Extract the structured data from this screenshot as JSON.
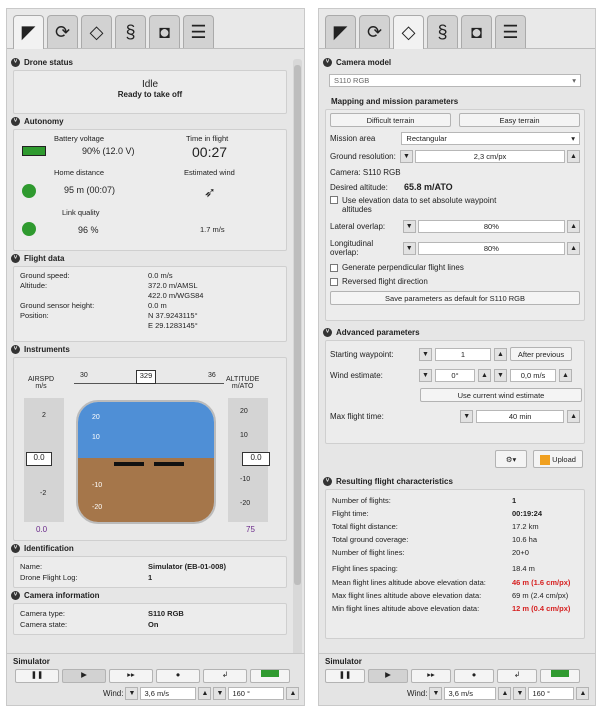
{
  "tabs": [
    "plane-icon",
    "refresh-icon",
    "diamond-icon",
    "spiral-icon",
    "camera-icon",
    "sliders-icon"
  ],
  "left": {
    "drone_status": {
      "title": "Drone status",
      "state": "Idle",
      "sub": "Ready to take off"
    },
    "autonomy": {
      "title": "Autonomy",
      "battery_label": "Battery voltage",
      "battery_value": "90% (12.0 V)",
      "time_label": "Time in flight",
      "time_value": "00:27",
      "home_label": "Home distance",
      "home_value": "95 m (00:07)",
      "wind_label": "Estimated wind",
      "wind_value": "1.7 m/s",
      "link_label": "Link quality",
      "link_value": "96 %"
    },
    "flight_data": {
      "title": "Flight data",
      "rows": [
        {
          "k": "Ground speed:",
          "v": "0.0 m/s"
        },
        {
          "k": "Altitude:",
          "v": "372.0 m/AMSL",
          "v2": "422.0 m/WGS84"
        },
        {
          "k": "Ground sensor height:",
          "v": "0.0 m"
        },
        {
          "k": "Position:",
          "v": "N 37.9243115°",
          "v2": "E 29.1283145°"
        }
      ]
    },
    "instruments": {
      "title": "Instruments",
      "heading": "329",
      "hdg_left": "30",
      "hdg_right": "36",
      "airspd_label": "AIRSPD",
      "airspd_unit": "m/s",
      "alt_label": "ALTITUDE",
      "alt_unit": "m/ATO",
      "speed_box": "0.0",
      "alt_box": "0.0",
      "speed_bottom": "0.0",
      "alt_bottom": "75",
      "spd_ticks": [
        "2",
        "-2"
      ],
      "alt_ticks": [
        "20",
        "10",
        "-10",
        "-20"
      ],
      "pitch_up": [
        "20",
        "10"
      ],
      "pitch_down": [
        "-10",
        "-20"
      ]
    },
    "identification": {
      "title": "Identification",
      "name_k": "Name:",
      "name_v": "Simulator (EB-01-008)",
      "log_k": "Drone Flight Log:",
      "log_v": "1"
    },
    "camera_info": {
      "title": "Camera information",
      "type_k": "Camera type:",
      "type_v": "S110 RGB",
      "state_k": "Camera state:",
      "state_v": "On"
    }
  },
  "simulator": {
    "title": "Simulator",
    "wind_label": "Wind:",
    "wind_speed": "3,6 m/s",
    "wind_dir": "160 °"
  },
  "right": {
    "camera_model": {
      "title": "Camera model",
      "value": "S110 RGB"
    },
    "mapping": {
      "title": "Mapping and mission parameters",
      "difficult": "Difficult terrain",
      "easy": "Easy terrain",
      "area_k": "Mission area",
      "area_v": "Rectangular",
      "gr_k": "Ground resolution:",
      "gr_v": "2,3 cm/px",
      "camera_line": "Camera: S110 RGB",
      "alt_k": "Desired altitude:",
      "alt_v": "65.8 m/ATO",
      "elev_chk": "Use elevation data to set absolute waypoint altitudes",
      "lat_k": "Lateral overlap:",
      "lat_v": "80%",
      "lon_k": "Longitudinal overlap:",
      "lon_v": "80%",
      "perp_chk": "Generate perpendicular flight lines",
      "rev_chk": "Reversed flight direction",
      "save": "Save parameters as default for S110 RGB"
    },
    "advanced": {
      "title": "Advanced parameters",
      "start_k": "Starting waypoint:",
      "start_v": "1",
      "after": "After previous",
      "wind_k": "Wind estimate:",
      "wind_dir": "0°",
      "wind_speed": "0,0 m/s",
      "use_wind": "Use current wind estimate",
      "max_k": "Max flight time:",
      "max_v": "40 min"
    },
    "upload": "Upload",
    "results": {
      "title": "Resulting flight characteristics",
      "rows": [
        {
          "k": "Number of flights:",
          "v": "1",
          "bold": true
        },
        {
          "k": "Flight time:",
          "v": "00:19:24",
          "bold": true
        },
        {
          "k": "Total flight distance:",
          "v": "17.2 km"
        },
        {
          "k": "Total ground coverage:",
          "v": "10.6 ha"
        },
        {
          "k": "Number of flight lines:",
          "v": "20+0"
        },
        {
          "k": "Flight lines spacing:",
          "v": "18.4 m"
        },
        {
          "k": "Mean flight lines altitude above elevation data:",
          "v": "46 m (1.6 cm/px)",
          "red": true
        },
        {
          "k": "Max flight lines altitude above elevation data:",
          "v": "69 m (2.4 cm/px)"
        },
        {
          "k": "Min flight lines altitude above elevation data:",
          "v": "12 m (0.4 cm/px)",
          "red": true
        }
      ]
    }
  },
  "colors": {
    "sky": "#4f8fd6",
    "ground": "#a5764a",
    "accent_orange": "#f0a020",
    "battery_green": "#2f9a2f"
  }
}
